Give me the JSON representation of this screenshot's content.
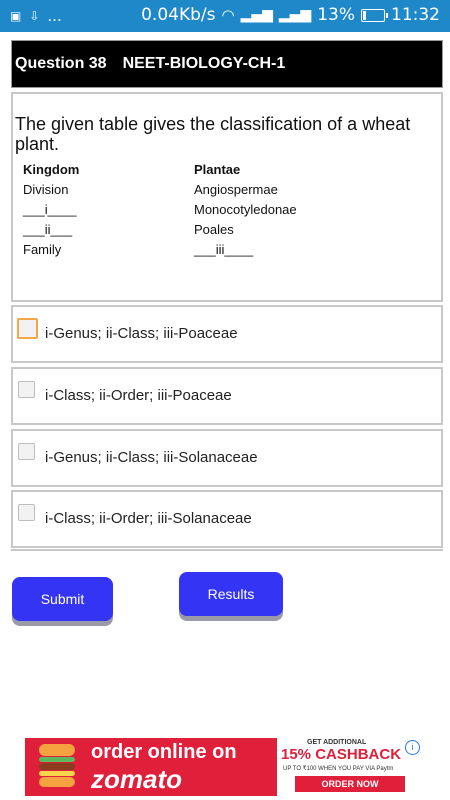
{
  "status_bar": {
    "left_icons": [
      "image-icon",
      "download-icon",
      "more-icon"
    ],
    "more_text": "...",
    "speed": "0.04Kb/s",
    "battery": "13%",
    "time": "11:32"
  },
  "header": {
    "question_number": "Question 38",
    "chapter": "NEET-BIOLOGY-CH-1"
  },
  "question": {
    "text": "The given table gives the classification of a wheat plant.",
    "table": [
      {
        "left": "Kingdom",
        "right": "Plantae"
      },
      {
        "left": "Division",
        "right": "Angiospermae"
      },
      {
        "left": "___i____",
        "right": "Monocotyledonae"
      },
      {
        "left": "___ii___",
        "right": "Poales"
      },
      {
        "left": "Family",
        "right": "___iii____"
      }
    ]
  },
  "options": [
    {
      "label": "i-Genus; ii-Class; iii-Poaceae",
      "checked": false
    },
    {
      "label": "i-Class; ii-Order; iii-Poaceae",
      "checked": false
    },
    {
      "label": "i-Genus; ii-Class; iii-Solanaceae",
      "checked": false
    },
    {
      "label": "i-Class; ii-Order; iii-Solanaceae",
      "checked": false
    }
  ],
  "buttons": {
    "submit": "Submit",
    "results": "Results"
  },
  "ad": {
    "line1": "order online on",
    "line2": "zomato",
    "small": "GET ADDITIONAL",
    "cashback": "15% CASHBACK",
    "upto": "UP TO ₹100 WHEN YOU PAY VIA Paytm",
    "order": "ORDER NOW",
    "info_glyph": "i",
    "close_glyph": "✕"
  },
  "colors": {
    "status_bar": "#1e88c8",
    "header_bg": "#000000",
    "button": "#3434f5",
    "focus_outline": "#f5a64a",
    "ad_red": "#e01f3a"
  }
}
